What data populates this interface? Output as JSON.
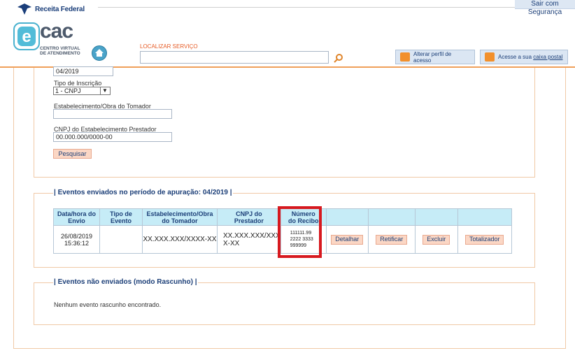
{
  "header": {
    "brand": "Receita Federal",
    "sair": "Sair com Segurança",
    "ecac_big": "cac",
    "ecac_sub_1": "CENTRO VIRTUAL",
    "ecac_sub_2": "DE ATENDIMENTO",
    "localizar_label": "LOCALIZAR SERVIÇO",
    "localizar_value": "",
    "perfil_label": "Alterar perfil de acesso",
    "caixa_prefix": "Acesse a sua ",
    "caixa_link": "caixa postal"
  },
  "filters": {
    "date_value": "04/2019",
    "tipo_label": "Tipo de Inscrição",
    "tipo_value": "1 - CNPJ",
    "estab_label": "Estabelecimento/Obra do Tomador",
    "estab_value": "",
    "cnpj_label": "CNPJ do Estabelecimento Prestador",
    "cnpj_value": "00.000.000/0000-00",
    "pesquisar": "Pesquisar"
  },
  "sent": {
    "legend": "| Eventos enviados no período de apuração: 04/2019 |",
    "columns": [
      [
        "Data/hora do",
        "Envio"
      ],
      [
        "Tipo de",
        "Evento"
      ],
      [
        "Estabelecimento/Obra",
        "do Tomador"
      ],
      [
        "CNPJ do",
        "Prestador"
      ],
      [
        "Número",
        "do Recibo"
      ]
    ],
    "row": {
      "date": "26/08/2019",
      "time": "15:36:12",
      "tipo": "",
      "estab": "XX.XXX.XXX/XXXX-XX",
      "cnpj_1": "XX.XXX.XXX/XXX",
      "cnpj_2": "X-XX",
      "recibo_1": "111111.99",
      "recibo_2": "2222 3333",
      "recibo_3": "999999"
    },
    "actions": [
      "Detalhar",
      "Retificar",
      "Excluir",
      "Totalizador"
    ]
  },
  "draft": {
    "legend": "| Eventos não enviados (modo Rascunho) |",
    "empty_text": "Nenhum evento rascunho encontrado."
  },
  "colors": {
    "accent_orange": "#f0a05a",
    "header_blue": "#c6ecf7",
    "button_pink": "#fbd7c5",
    "highlight_red": "#d7191f"
  }
}
